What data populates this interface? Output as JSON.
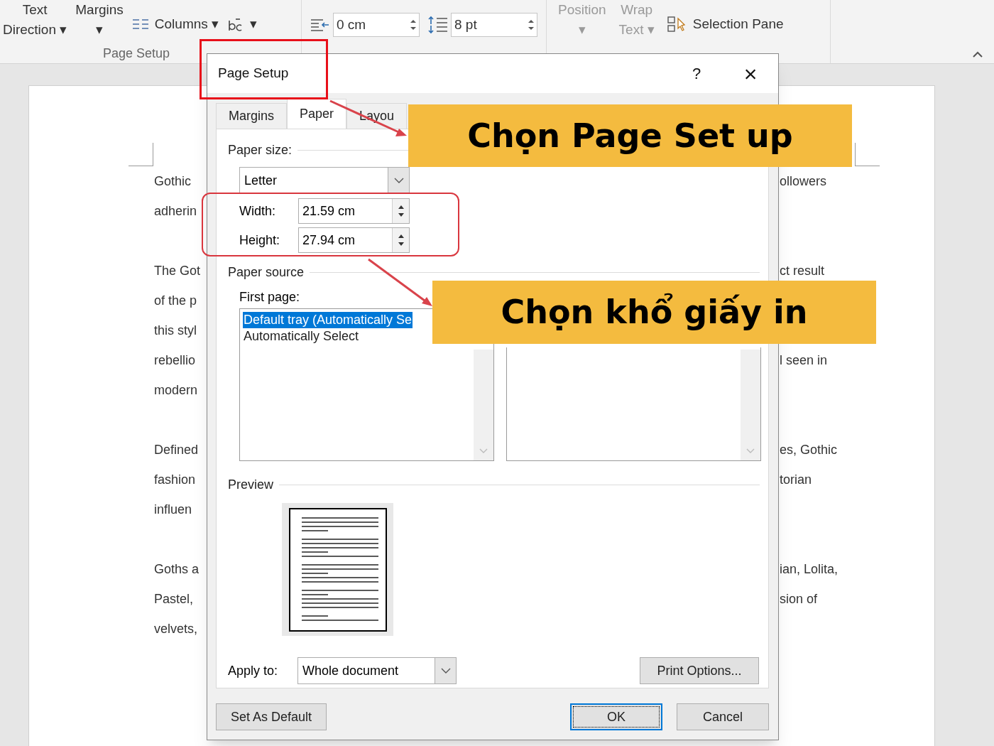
{
  "ribbon": {
    "groups": [
      {
        "label": "Page Setup",
        "items": [
          {
            "kind": "large",
            "top": "Text",
            "bottom": "Direction ▾",
            "disabled": false
          },
          {
            "kind": "large",
            "top": "Margins",
            "bottom": "▾",
            "disabled": false
          },
          {
            "kind": "small",
            "label": "Columns ▾",
            "disabled": false
          },
          {
            "kind": "small",
            "label": "▾",
            "disabled": false
          }
        ]
      },
      {
        "items": [
          {
            "kind": "spinner",
            "value": "0 cm",
            "disabled": false
          },
          {
            "kind": "spinner",
            "value": "8 pt",
            "disabled": false
          }
        ]
      },
      {
        "items": [
          {
            "kind": "large",
            "top": "Position",
            "bottom": "▾",
            "disabled": true
          },
          {
            "kind": "large",
            "top": "Wrap",
            "bottom": "Text ▾",
            "disabled": true
          },
          {
            "kind": "small",
            "label": "Selection Pane",
            "disabled": false
          }
        ]
      }
    ]
  },
  "document": {
    "paragraphs": [
      {
        "lines": [
          {
            "left": "Gothic",
            "right": "ollowers"
          },
          {
            "left": "adherin"
          }
        ]
      },
      {
        "lines": [
          {
            "left": "The Got",
            "right": "ct result"
          },
          {
            "left": "of the p"
          },
          {
            "left": "this styl"
          },
          {
            "left": "rebellio",
            "right": "l seen in"
          },
          {
            "left": "modern"
          }
        ]
      },
      {
        "lines": [
          {
            "left": "Defined",
            "right": "es, Gothic"
          },
          {
            "left": "fashion",
            "right": "torian"
          },
          {
            "left": "influen"
          }
        ]
      },
      {
        "lines": [
          {
            "left": "Goths a",
            "right": "ian, Lolita,"
          },
          {
            "left": "Pastel,",
            "right": "sion of"
          },
          {
            "left": "velvets,"
          }
        ]
      }
    ]
  },
  "dialog": {
    "title": "Page Setup",
    "help": "?",
    "close": "×",
    "tabs": [
      {
        "label": "Margins",
        "selected": false
      },
      {
        "label": "Paper",
        "selected": true
      },
      {
        "label": "Layou",
        "selected": false
      }
    ],
    "paper_size": {
      "heading": "Paper size:",
      "value": "Letter",
      "width_label": "Width:",
      "width": "21.59 cm",
      "height_label": "Height:",
      "height": "27.94 cm"
    },
    "paper_source": {
      "heading": "Paper source",
      "first_page_label": "First page:",
      "first_page_items": [
        {
          "label": "Default tray (Automatically Se",
          "selected": true
        },
        {
          "label": "Automatically Select",
          "selected": false
        }
      ]
    },
    "preview": {
      "heading": "Preview"
    },
    "apply_to": {
      "label": "Apply to:",
      "value": "Whole document"
    },
    "print_options": "Print Options...",
    "buttons": [
      {
        "label": "Set As Default",
        "default": false
      },
      {
        "label": "OK",
        "default": true
      },
      {
        "label": "Cancel",
        "default": false
      }
    ]
  },
  "annotations": [
    {
      "kind": "callout",
      "text": "Chọn Page Set up"
    },
    {
      "kind": "callout",
      "text": "Chọn khổ giấy in"
    }
  ]
}
